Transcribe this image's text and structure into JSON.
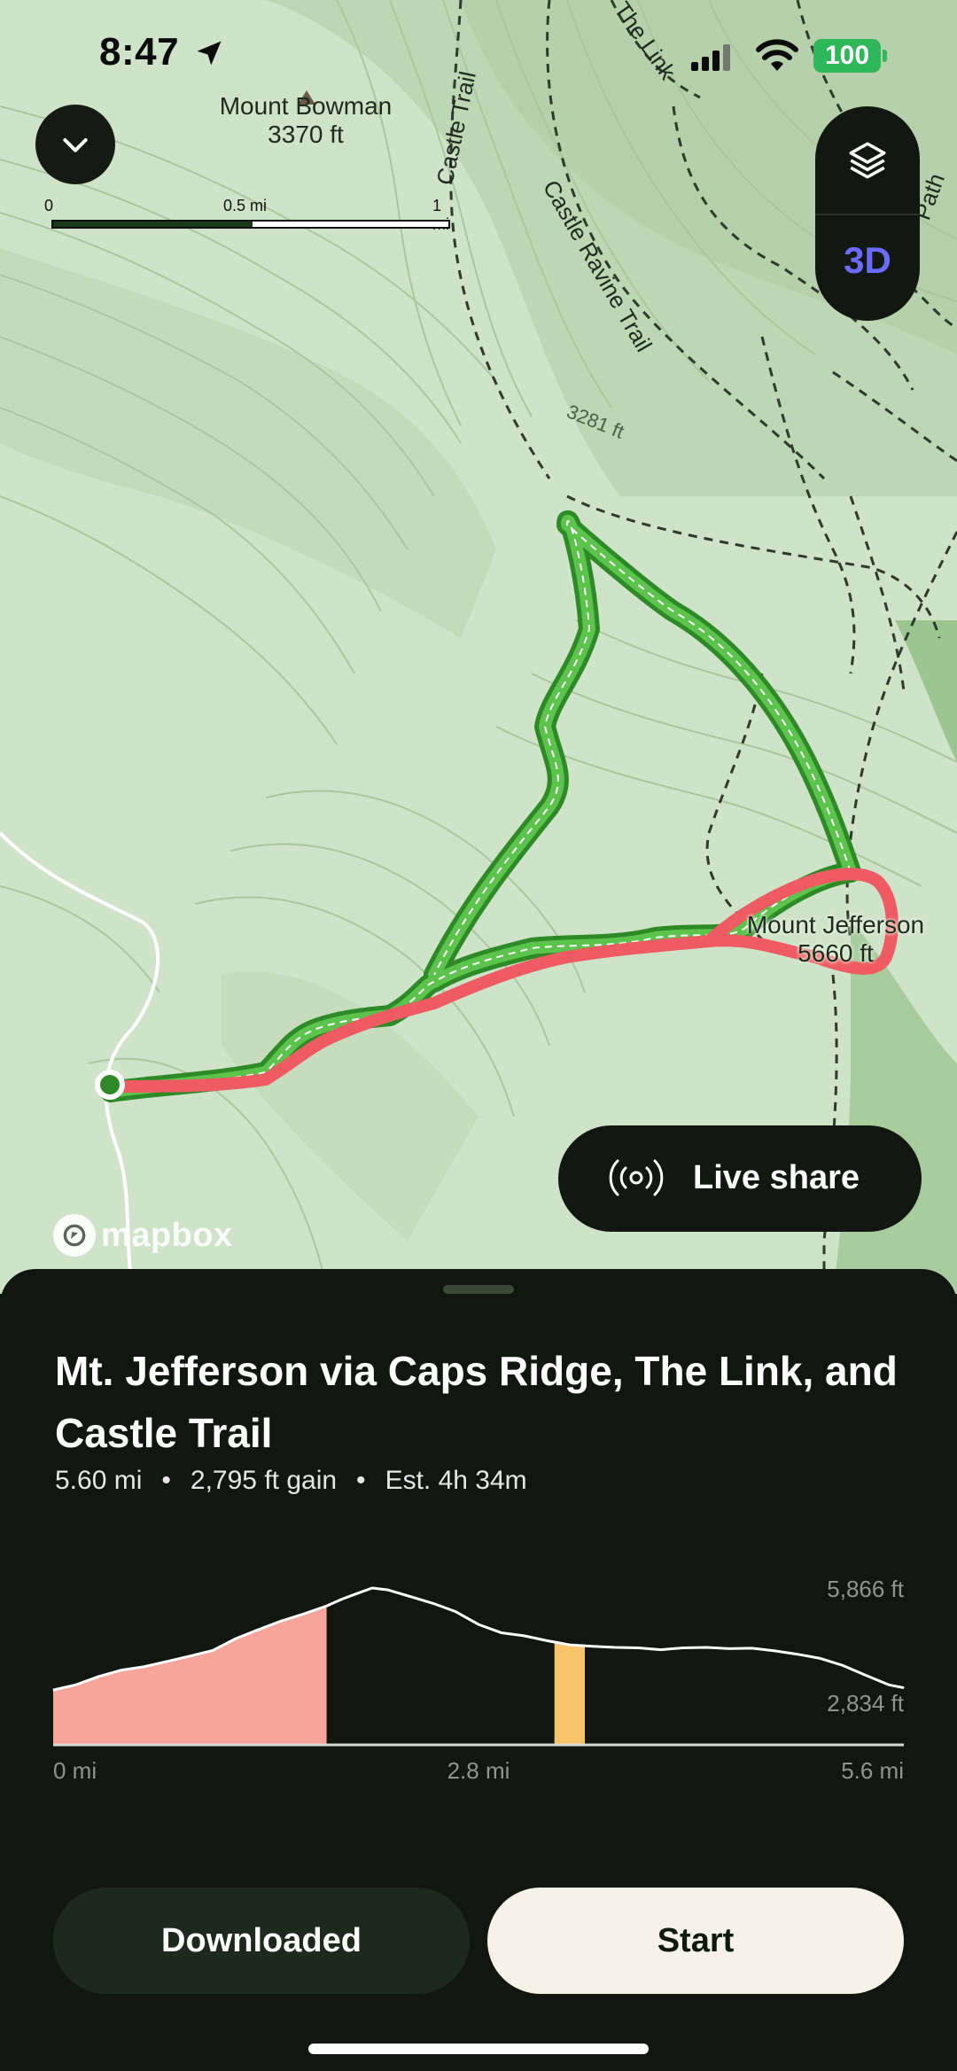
{
  "status_bar": {
    "time": "8:47",
    "battery": "100"
  },
  "map": {
    "peak_bowman": {
      "name": "Mount Bowman",
      "elevation": "3370 ft"
    },
    "peak_jefferson": {
      "name": "Mount Jefferson",
      "elevation": "5660 ft"
    },
    "scale": {
      "start": "0",
      "mid": "0.5 mi",
      "end": "1 mi"
    },
    "trail_labels": {
      "castle_trail": "Castle Trail",
      "castle_ravine": "Castle Ravine Trail",
      "the_link": "The Link",
      "path": "Path",
      "contour": "3281 ft"
    },
    "map_controls": {
      "three_d": "3D"
    },
    "live_share": "Live share",
    "attribution": "mapbox",
    "colors": {
      "planned_route": "#3fae32",
      "recorded_track": "#ef5b62"
    },
    "icons": [
      "chevron-down-icon",
      "layers-icon",
      "broadcast-icon",
      "location-arrow-icon",
      "wifi-icon",
      "cellular-signal-icon",
      "mountain-peak-icon",
      "mapbox-logo-icon"
    ]
  },
  "sheet": {
    "title": "Mt. Jefferson via Caps Ridge, The Link, and Castle Trail",
    "stats": {
      "distance": "5.60 mi",
      "gain": "2,795 ft gain",
      "estimate": "Est. 4h 34m"
    },
    "buttons": {
      "downloaded": "Downloaded",
      "start": "Start"
    }
  },
  "chart_data": {
    "type": "area",
    "title": "",
    "xlabel": "",
    "ylabel": "",
    "x_tick_labels": [
      "0 mi",
      "2.8 mi",
      "5.6 mi"
    ],
    "y_tick_labels": [
      "5,866 ft",
      "2,834 ft"
    ],
    "xlim": [
      0,
      5.6
    ],
    "ylim": [
      2834,
      5866
    ],
    "series": [
      {
        "x": [
          0,
          0.15,
          0.3,
          0.45,
          0.6,
          0.75,
          0.9,
          1.05,
          1.2,
          1.35,
          1.5,
          1.65,
          1.8,
          1.9,
          2.0,
          2.1,
          2.2,
          2.35,
          2.5,
          2.65,
          2.8,
          2.95,
          3.1,
          3.25,
          3.4,
          3.55,
          3.7,
          3.85,
          4.0,
          4.15,
          4.3,
          4.45,
          4.6,
          4.75,
          4.9,
          5.05,
          5.2,
          5.35,
          5.5,
          5.6
        ],
        "y": [
          3160,
          3300,
          3520,
          3690,
          3780,
          3920,
          4060,
          4210,
          4520,
          4760,
          4990,
          5180,
          5390,
          5570,
          5720,
          5866,
          5820,
          5640,
          5460,
          5240,
          4900,
          4680,
          4600,
          4470,
          4360,
          4320,
          4290,
          4280,
          4230,
          4280,
          4290,
          4260,
          4270,
          4200,
          4110,
          4000,
          3810,
          3550,
          3300,
          3220
        ]
      }
    ],
    "highlights": [
      {
        "x_start": 0,
        "x_end": 1.8,
        "color": "#f7a59b"
      },
      {
        "x_start": 3.3,
        "x_end": 3.5,
        "color": "#f8c46a"
      }
    ]
  }
}
